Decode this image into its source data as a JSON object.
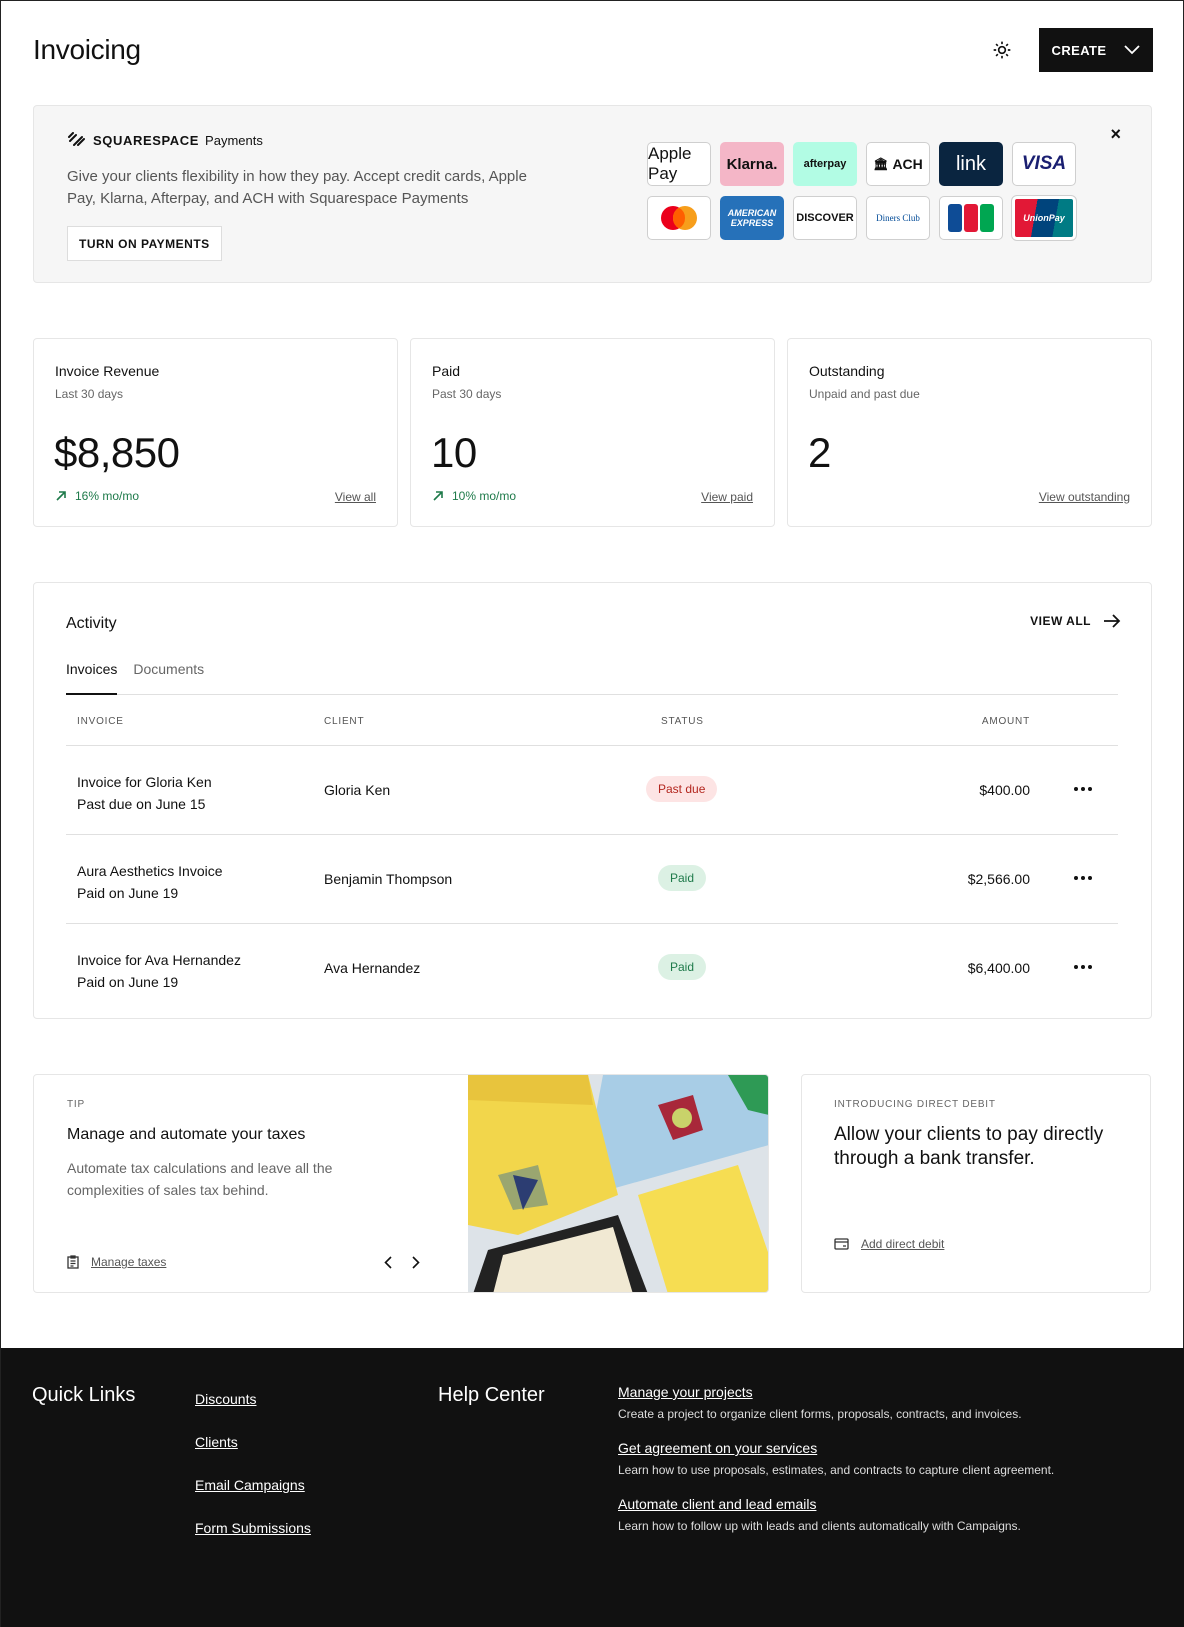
{
  "header": {
    "title": "Invoicing",
    "create_label": "CREATE"
  },
  "banner": {
    "brand_name": "SQUARESPACE",
    "brand_product": "Payments",
    "text": "Give your clients flexibility in how they pay. Accept credit cards, Apple Pay, Klarna, Afterpay, and ACH with Squarespace Payments",
    "button_label": "TURN ON PAYMENTS",
    "close_label": "×",
    "methods": [
      "Apple Pay",
      "Klarna.",
      "afterpay",
      "ACH",
      "link",
      "VISA",
      "Mastercard",
      "AMERICAN EXPRESS",
      "DISCOVER",
      "Diners Club",
      "JCB",
      "UnionPay"
    ]
  },
  "stats": [
    {
      "title": "Invoice Revenue",
      "subtitle": "Last 30 days",
      "value": "$8,850",
      "trend": "16% mo/mo",
      "link": "View all"
    },
    {
      "title": "Paid",
      "subtitle": "Past 30 days",
      "value": "10",
      "trend": "10% mo/mo",
      "link": "View paid"
    },
    {
      "title": "Outstanding",
      "subtitle": "Unpaid and past due",
      "value": "2",
      "trend": "",
      "link": "View outstanding"
    }
  ],
  "activity": {
    "title": "Activity",
    "view_all": "VIEW ALL",
    "tabs": [
      "Invoices",
      "Documents"
    ],
    "columns": [
      "INVOICE",
      "CLIENT",
      "STATUS",
      "AMOUNT"
    ],
    "rows": [
      {
        "name": "Invoice for Gloria Ken",
        "detail": "Past due on June 15",
        "client": "Gloria Ken",
        "status": "Past due",
        "amount": "$400.00"
      },
      {
        "name": "Aura Aesthetics Invoice",
        "detail": "Paid on June 19",
        "client": "Benjamin Thompson",
        "status": "Paid",
        "amount": "$2,566.00"
      },
      {
        "name": "Invoice for Ava Hernandez",
        "detail": "Paid on June 19",
        "client": "Ava Hernandez",
        "status": "Paid",
        "amount": "$6,400.00"
      }
    ]
  },
  "tip": {
    "eyebrow": "TIP",
    "title": "Manage and automate your taxes",
    "body": "Automate tax calculations and leave all the complexities of sales tax behind.",
    "link": "Manage taxes"
  },
  "debit": {
    "eyebrow": "INTRODUCING DIRECT DEBIT",
    "title": "Allow your clients to pay directly through a bank transfer.",
    "link": "Add direct debit"
  },
  "footer": {
    "quick_links_title": "Quick Links",
    "quick_links": [
      "Discounts",
      "Clients",
      "Email Campaigns",
      "Form Submissions"
    ],
    "help_title": "Help Center",
    "help_items": [
      {
        "title": "Manage your projects",
        "desc": "Create a project to organize client forms, proposals, contracts, and invoices."
      },
      {
        "title": "Get agreement on your services",
        "desc": "Learn how to use proposals, estimates, and contracts to capture client agreement."
      },
      {
        "title": "Automate client and lead emails",
        "desc": "Learn how to follow up with leads and clients automatically with Campaigns."
      }
    ]
  },
  "colors": {
    "accent": "#111111",
    "trend_green": "#1e7a4a",
    "past_due_bg": "#fde4e4",
    "past_due_text": "#b3261e",
    "paid_bg": "#dcf1e4",
    "paid_text": "#1e7a4a"
  }
}
